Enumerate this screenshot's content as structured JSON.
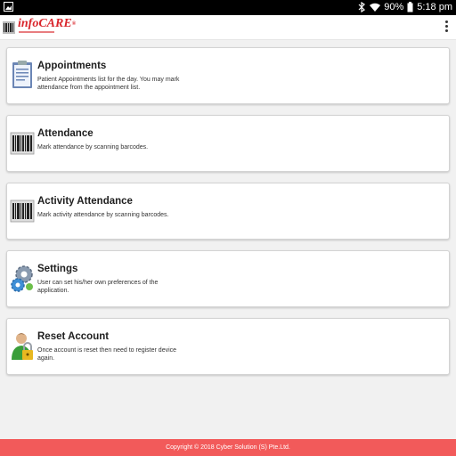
{
  "status_bar": {
    "battery": "90%",
    "time": "5:18 pm"
  },
  "app": {
    "logo_text": "infoCARE",
    "logo_mark": "®"
  },
  "menu": [
    {
      "title": "Appointments",
      "description": "Patient Appointments list for the day. You may mark attendance from the appointment list.",
      "icon": "clipboard-icon"
    },
    {
      "title": "Attendance",
      "description": "Mark attendance by scanning barcodes.",
      "icon": "barcode-scanner-icon"
    },
    {
      "title": "Activity Attendance",
      "description": "Mark activity attendance by scanning barcodes.",
      "icon": "barcode-scanner-icon"
    },
    {
      "title": "Settings",
      "description": "User can set his/her own preferences of the application.",
      "icon": "gears-icon"
    },
    {
      "title": "Reset Account",
      "description": "Once account is reset then need to register device again.",
      "icon": "user-lock-icon"
    }
  ],
  "footer": {
    "copyright": "Copyright © 2018 Cyber Solution (S) Pte.Ltd."
  },
  "colors": {
    "brand_red": "#d9262c",
    "footer_bg": "#f25a5a"
  }
}
